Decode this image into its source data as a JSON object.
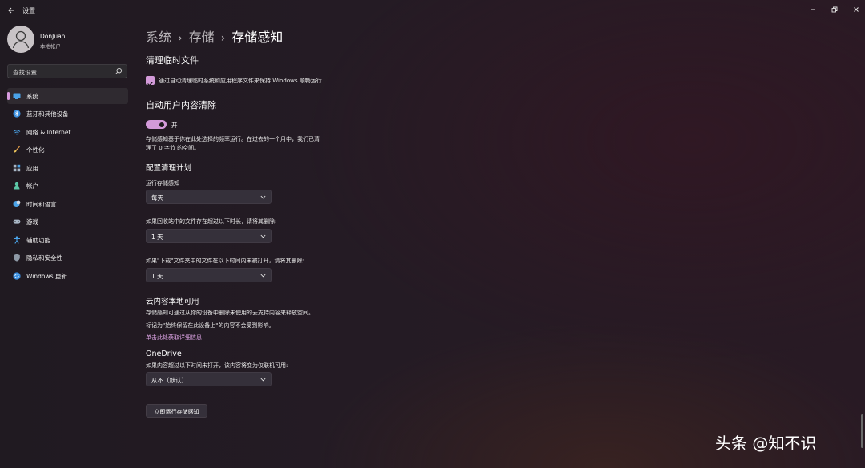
{
  "window": {
    "title": "设置"
  },
  "profile": {
    "name": "DonJuan",
    "account_type": "本地帐户"
  },
  "search": {
    "placeholder": "查找设置"
  },
  "sidebar": {
    "items": [
      {
        "label": "系统",
        "icon": "system-icon",
        "selected": true
      },
      {
        "label": "蓝牙和其他设备",
        "icon": "bluetooth-icon"
      },
      {
        "label": "网络 & Internet",
        "icon": "wifi-icon"
      },
      {
        "label": "个性化",
        "icon": "brush-icon"
      },
      {
        "label": "应用",
        "icon": "apps-icon"
      },
      {
        "label": "帐户",
        "icon": "person-icon"
      },
      {
        "label": "时间和语言",
        "icon": "globe-clock-icon"
      },
      {
        "label": "游戏",
        "icon": "gamepad-icon"
      },
      {
        "label": "辅助功能",
        "icon": "accessibility-icon"
      },
      {
        "label": "隐私和安全性",
        "icon": "shield-icon"
      },
      {
        "label": "Windows 更新",
        "icon": "windows-update-icon"
      }
    ]
  },
  "breadcrumb": {
    "parts": [
      "系统",
      "存储"
    ],
    "current": "存储感知"
  },
  "temp_files": {
    "title": "清理临时文件",
    "checkbox_label": "通过自动清理临时系统和应用程序文件来保持 Windows 顺畅运行",
    "checked": true
  },
  "auto_cleanup": {
    "title": "自动用户内容清除",
    "toggle_state": "开",
    "toggle_on": true,
    "description_line1": "存储感知基于你在此处选择的频率运行。在过去的一个月中，我们已清",
    "description_line2": "理了 0 字节 的空间。"
  },
  "schedule": {
    "title": "配置清理计划",
    "run_label": "运行存储感知",
    "run_value": "每天",
    "recycle_label": "如果回收站中的文件存在超过以下时长，请将其删除:",
    "recycle_value": "1 天",
    "downloads_label": "如果\"下载\"文件夹中的文件在以下时间内未被打开，请将其删除:",
    "downloads_value": "1 天"
  },
  "cloud": {
    "title": "云内容本地可用",
    "line1": "存储感知可通过从你的设备中删除未使用的云支持内容来释放空间。",
    "line2": "标记为\"始终保留在此设备上\"的内容不会受到影响。",
    "link": "单击此处获取详细信息"
  },
  "onedrive": {
    "title": "OneDrive",
    "label": "如果内容超过以下时间未打开，该内容将变为仅联机可用:",
    "value": "从不（默认）"
  },
  "actions": {
    "run_now": "立即运行存储感知"
  },
  "watermark": {
    "text": "头条 @知不识"
  },
  "colors": {
    "accent": "#d39ad9",
    "link": "#e0a6e8",
    "background": "#241b24"
  }
}
